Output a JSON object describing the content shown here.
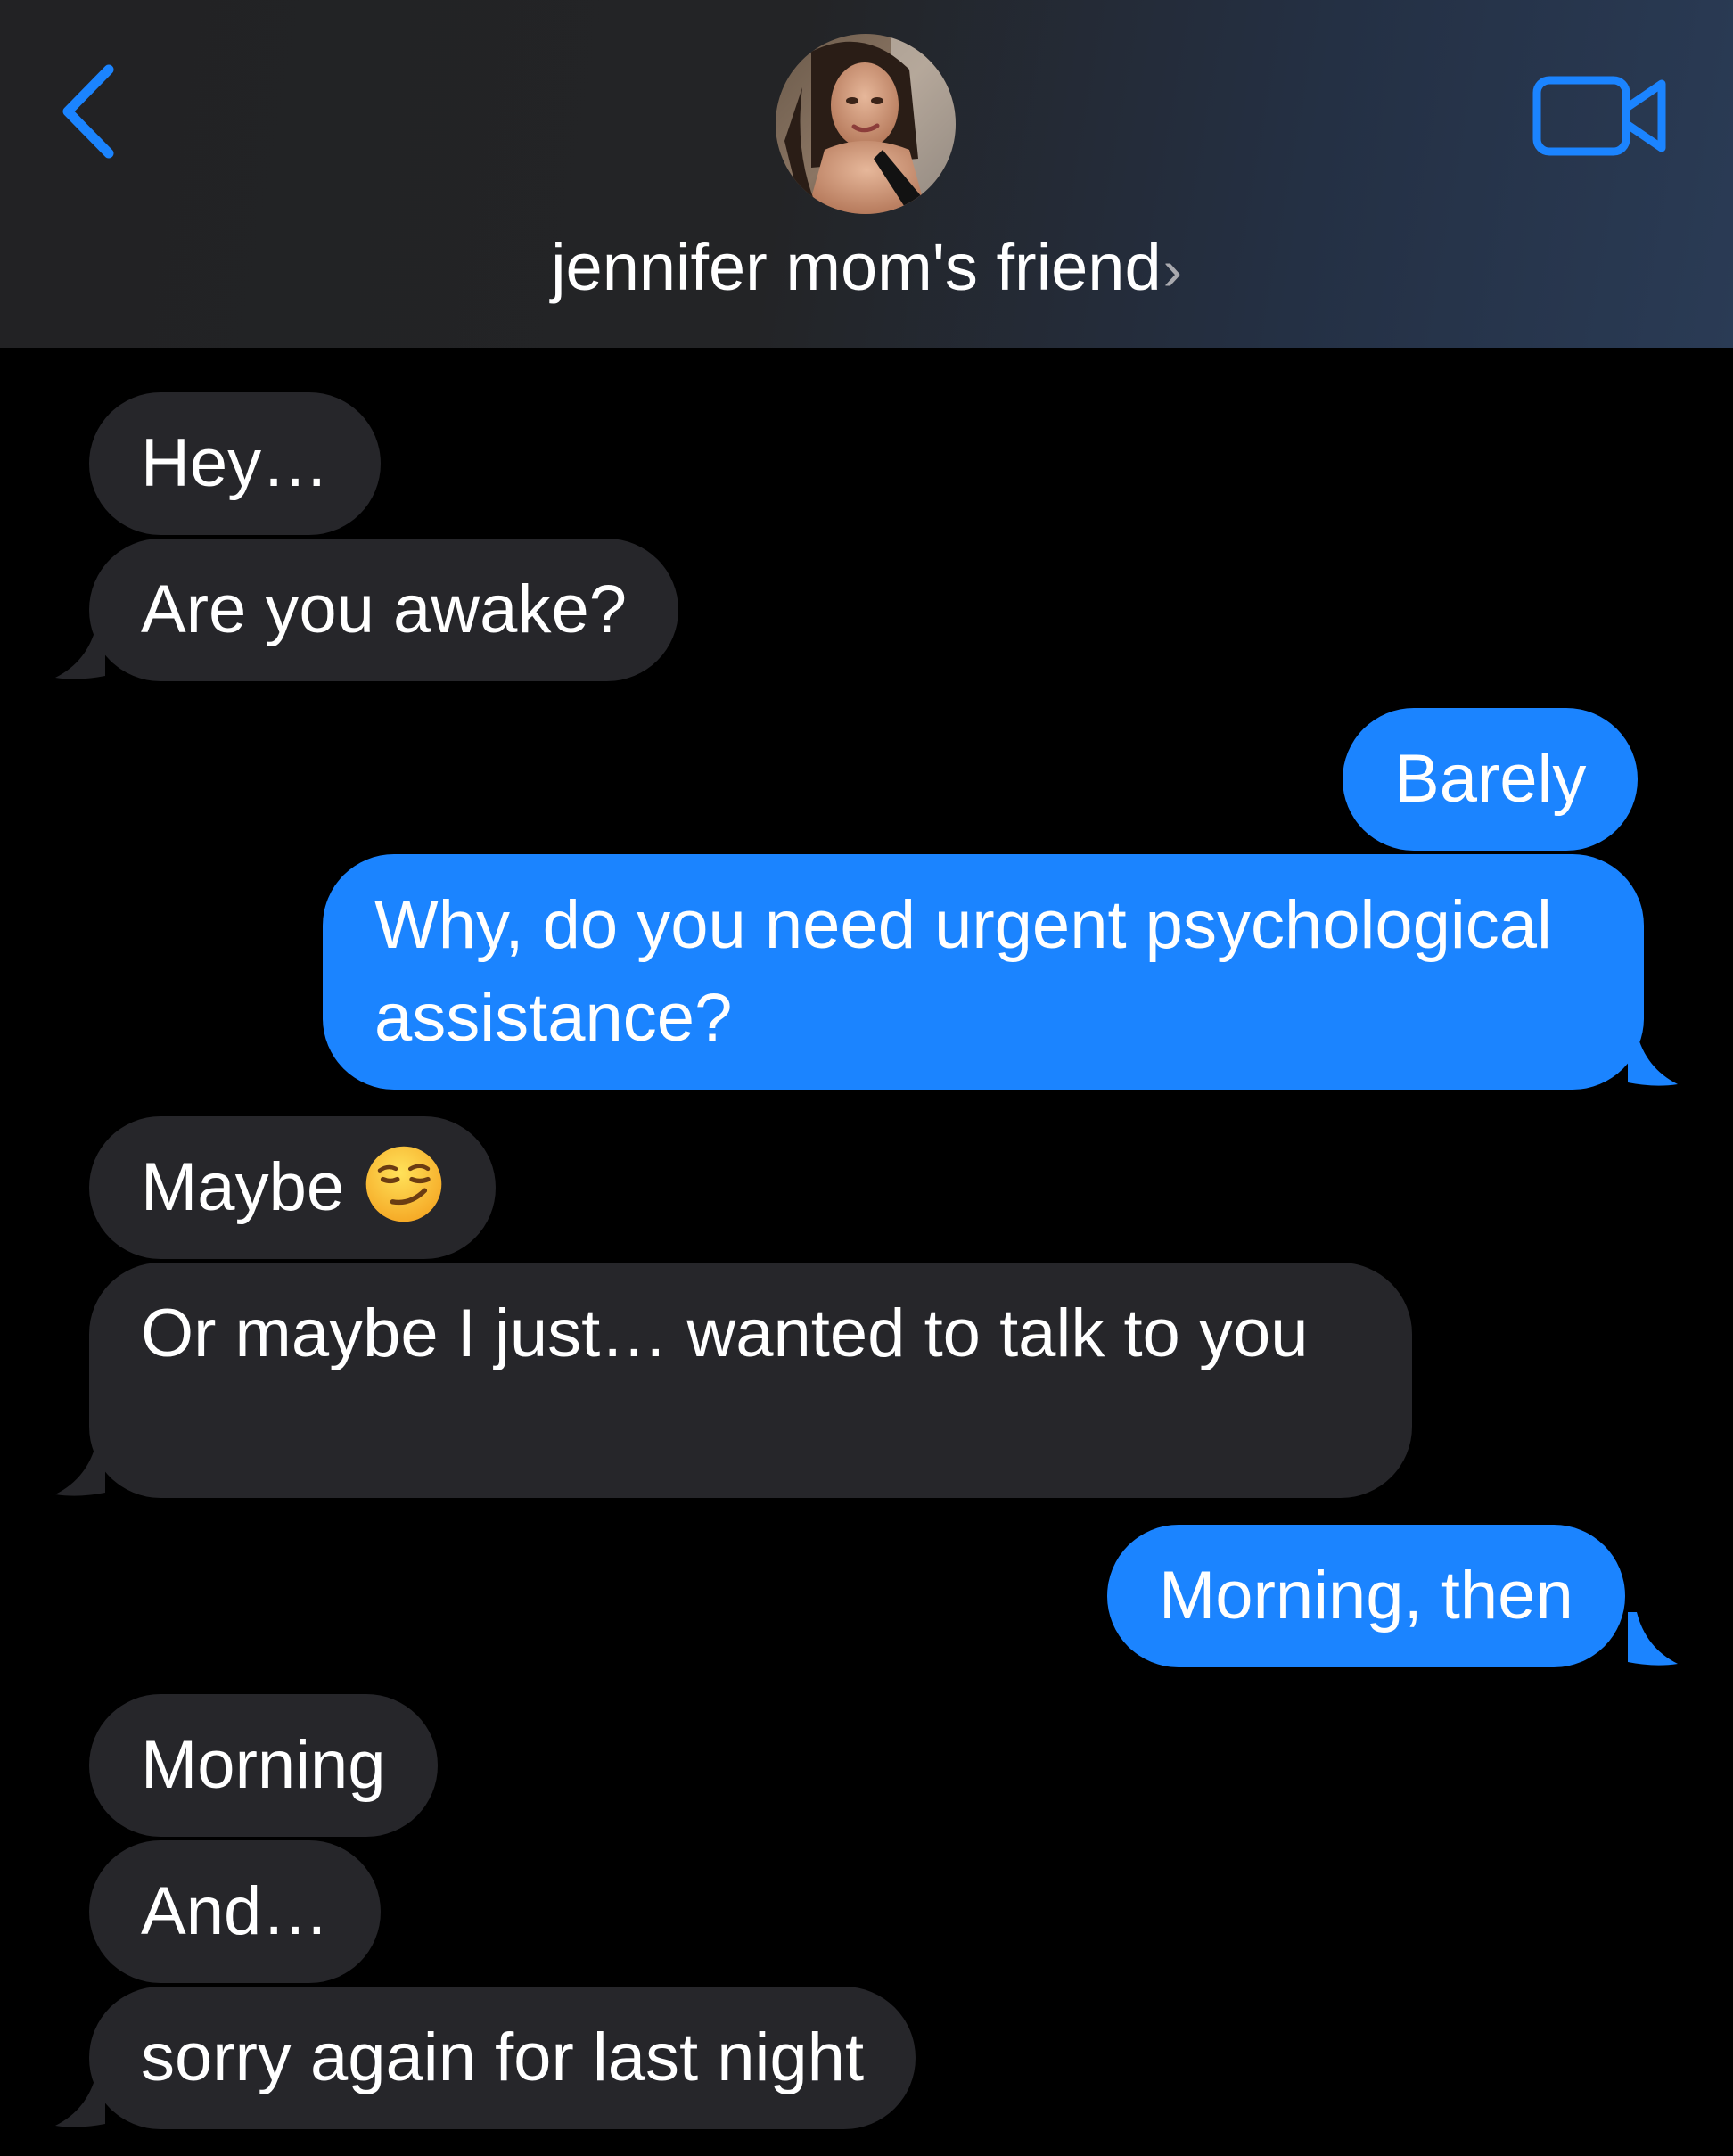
{
  "header": {
    "contact_name": "jennifer mom's friend",
    "chevron": "›",
    "back_icon": "chevron-left",
    "video_icon": "video-camera"
  },
  "colors": {
    "accent": "#1b84ff",
    "incoming_bubble": "#26262a",
    "background": "#000000"
  },
  "messages": [
    {
      "id": "m1",
      "direction": "incoming",
      "text": "Hey…"
    },
    {
      "id": "m2",
      "direction": "incoming",
      "text": "Are you awake?"
    },
    {
      "id": "m3",
      "direction": "outgoing",
      "text": "Barely"
    },
    {
      "id": "m4",
      "direction": "outgoing",
      "text": "Why, do you need urgent psychological assistance?"
    },
    {
      "id": "m5",
      "direction": "incoming",
      "text": "Maybe",
      "emoji": "smirking-face"
    },
    {
      "id": "m6",
      "direction": "incoming",
      "text": "Or maybe I just… wanted to talk to you"
    },
    {
      "id": "m7",
      "direction": "outgoing",
      "text": "Morning, then"
    },
    {
      "id": "m8",
      "direction": "incoming",
      "text": "Morning"
    },
    {
      "id": "m9",
      "direction": "incoming",
      "text": "And…"
    },
    {
      "id": "m10",
      "direction": "incoming",
      "text": "sorry again for last night"
    }
  ]
}
